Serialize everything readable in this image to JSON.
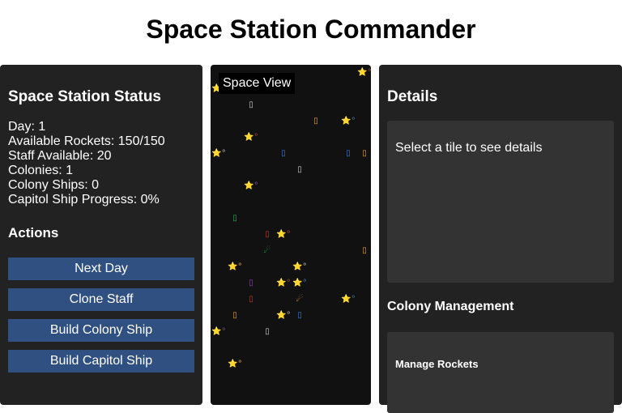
{
  "title": "Space Station Commander",
  "status": {
    "heading": "Space Station Status",
    "lines": [
      "Day: 1",
      "Available Rockets: 150/150",
      "Staff Available: 20",
      "Colonies: 1",
      "Colony Ships: 0",
      "Capitol Ship Progress: 0%"
    ]
  },
  "actions": {
    "heading": "Actions",
    "buttons": [
      "Next Day",
      "Clone Staff",
      "Build Colony Ship",
      "Build Capitol Ship"
    ]
  },
  "space_view": {
    "label": "Space View",
    "tiles": [
      {
        "glyph": "⭐°",
        "color": "#c0392b"
      },
      {
        "glyph": "⭐°",
        "color": "#8e44ad"
      },
      {
        "glyph": "▯",
        "color": "#cccccc"
      },
      {
        "glyph": "▯",
        "color": "#e6a23c"
      },
      {
        "glyph": "⭐°",
        "color": "#3a7bd5"
      },
      {
        "glyph": "⭐°",
        "color": "#c0392b"
      },
      {
        "glyph": "⭐°",
        "color": "#bbbbbb"
      },
      {
        "glyph": "▯",
        "color": "#3a7bd5"
      },
      {
        "glyph": "▯",
        "color": "#3a7bd5"
      },
      {
        "glyph": "▯",
        "color": "#e6a23c"
      },
      {
        "glyph": "▯",
        "color": "#cccccc"
      },
      {
        "glyph": "⭐°",
        "color": "#8e44ad"
      },
      {
        "glyph": "▯",
        "color": "#27ae60"
      },
      {
        "glyph": "▯",
        "color": "#c0392b"
      },
      {
        "glyph": "⭐°",
        "color": "#c0392b"
      },
      {
        "glyph": "☄",
        "color": "#27ae60"
      },
      {
        "glyph": "▯",
        "color": "#e6a23c"
      },
      {
        "glyph": "⭐°",
        "color": "#e6a23c"
      },
      {
        "glyph": "⭐°",
        "color": "#bbbbbb"
      },
      {
        "glyph": "▯",
        "color": "#8e44ad"
      },
      {
        "glyph": "⭐°",
        "color": "#c0392b"
      },
      {
        "glyph": "⭐°",
        "color": "#3a7bd5"
      },
      {
        "glyph": "▯",
        "color": "#c0392b"
      },
      {
        "glyph": "☄",
        "color": "#e6a23c"
      },
      {
        "glyph": "⭐°",
        "color": "#3a7bd5"
      },
      {
        "glyph": "▯",
        "color": "#e6a23c"
      },
      {
        "glyph": "⭐°",
        "color": "#bbbbbb"
      },
      {
        "glyph": "▯",
        "color": "#3a7bd5"
      },
      {
        "glyph": "⭐°",
        "color": "#8e44ad"
      },
      {
        "glyph": "▯",
        "color": "#cccccc"
      },
      {
        "glyph": "⭐°",
        "color": "#e6a23c"
      }
    ]
  },
  "details": {
    "heading": "Details",
    "placeholder": "Select a tile to see details"
  },
  "colony": {
    "heading": "Colony Management",
    "sub_heading": "Manage Rockets"
  }
}
